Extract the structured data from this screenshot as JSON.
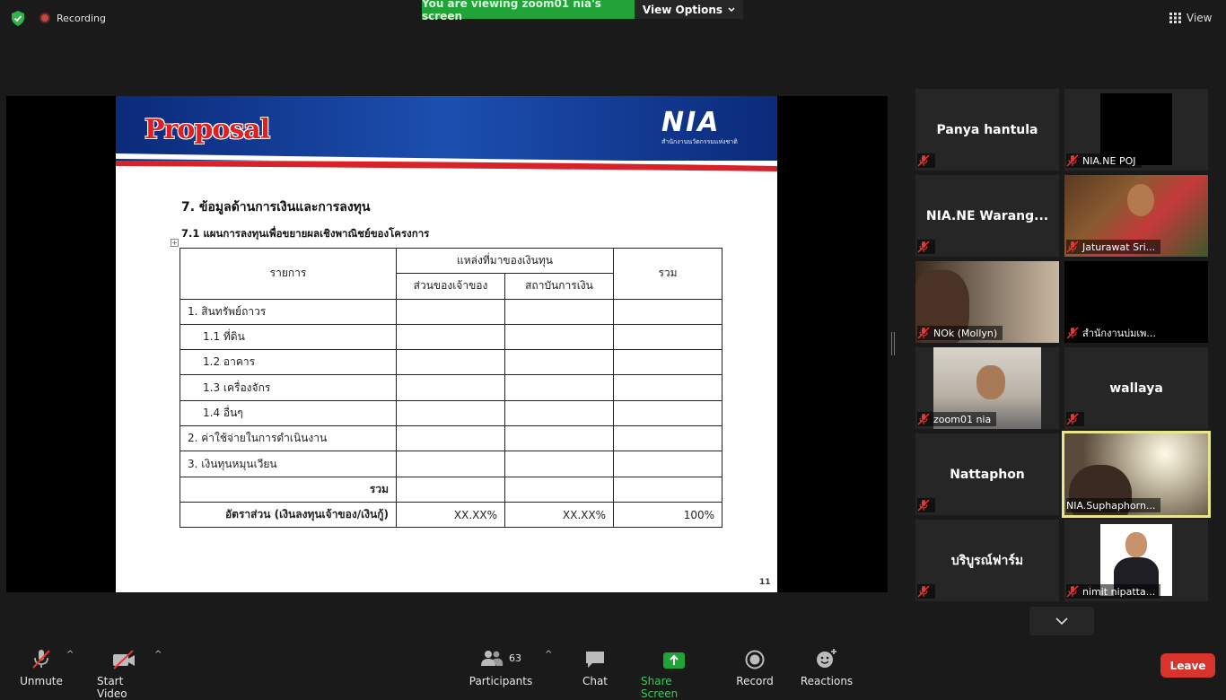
{
  "top": {
    "recording": "Recording",
    "viewing_banner": "You are viewing zoom01 nia's screen",
    "view_options": "View Options",
    "view_button": "View"
  },
  "slide": {
    "title": "Proposal",
    "logo": "NIA",
    "logo_sub": "สำนักงานนวัตกรรมแห่งชาติ",
    "section_heading": "7. ข้อมูลด้านการเงินและการลงทุน",
    "subheading": "7.1 แผนการลงทุนเพื่อขยายผลเชิงพาณิชย์ของโครงการ",
    "table": {
      "col_item": "รายการ",
      "col_source": "แหล่งที่มาของเงินทุน",
      "col_owner": "ส่วนของเจ้าของ",
      "col_finance": "สถาบันการเงิน",
      "col_total": "รวม",
      "rows": [
        "1. สินทรัพย์ถาวร",
        "1.1 ที่ดิน",
        "1.2 อาคาร",
        "1.3 เครื่องจักร",
        "1.4 อื่นๆ",
        "2. ค่าใช้จ่ายในการดำเนินงาน",
        "3. เงินทุนหมุนเวียน"
      ],
      "total_label": "รวม",
      "ratio_label": "อัตราส่วน (เงินลงทุนเจ้าของ/เงินกู้)",
      "ratio_owner": "XX.XX%",
      "ratio_finance": "XX.XX%",
      "ratio_total": "100%"
    },
    "page_number": "11"
  },
  "participants": [
    {
      "name": "Panya hantula"
    },
    {
      "name": "NIA.NE POJ"
    },
    {
      "name": "NIA.NE  Warang..."
    },
    {
      "name": "Jaturawat Sri..."
    },
    {
      "name": "NOk (Mollyn)"
    },
    {
      "name": "สำนักงานบ่มเพ..."
    },
    {
      "name": "zoom01 nia"
    },
    {
      "name": "wallaya"
    },
    {
      "name": "Nattaphon"
    },
    {
      "name": "NIA.Suphaphorn..."
    },
    {
      "name": "บริบูรณ์ฟาร์ม"
    },
    {
      "name": "nimit nipatta..."
    }
  ],
  "toolbar": {
    "unmute": "Unmute",
    "start_video": "Start Video",
    "participants": "Participants",
    "participants_count": "63",
    "chat": "Chat",
    "share_screen": "Share Screen",
    "record": "Record",
    "reactions": "Reactions",
    "leave": "Leave"
  },
  "colors": {
    "share_green": "#22a33a",
    "leave_red": "#d9342b",
    "active_speaker_border": "#e6e68a"
  }
}
